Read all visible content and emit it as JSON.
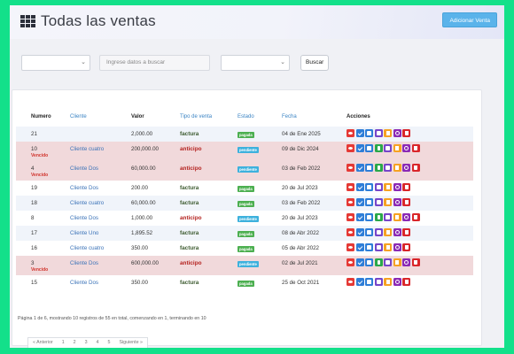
{
  "header": {
    "title": "Todas las ventas",
    "add_button": "Adicionar Venta"
  },
  "filters": {
    "search_placeholder": "Ingrese datos a buscar",
    "search_button": "Buscar"
  },
  "table": {
    "columns": [
      "Numero",
      "Cliente",
      "Valor",
      "Tipo de venta",
      "Estado",
      "Fecha",
      "Acciones"
    ],
    "rows": [
      {
        "numero": "21",
        "vencido": "",
        "cliente": "",
        "valor": "2,000.00",
        "tipo": "factura",
        "estado": "pagada",
        "fecha": "04 de Ene 2025"
      },
      {
        "numero": "10",
        "vencido": "Vencido",
        "cliente": "Cliente cuatro",
        "valor": "200,000.00",
        "tipo": "anticipo",
        "estado": "pendiente",
        "fecha": "09 de Dic 2024"
      },
      {
        "numero": "4",
        "vencido": "Vencido",
        "cliente": "Cliente Dos",
        "valor": "60,000.00",
        "tipo": "anticipo",
        "estado": "pendiente",
        "fecha": "03 de Feb 2022"
      },
      {
        "numero": "19",
        "vencido": "",
        "cliente": "Cliente Dos",
        "valor": "200.00",
        "tipo": "factura",
        "estado": "pagada",
        "fecha": "20 de Jul 2023"
      },
      {
        "numero": "18",
        "vencido": "",
        "cliente": "Cliente cuatro",
        "valor": "60,000.00",
        "tipo": "factura",
        "estado": "pagada",
        "fecha": "03 de Feb 2022"
      },
      {
        "numero": "8",
        "vencido": "",
        "cliente": "Cliente Dos",
        "valor": "1,000.00",
        "tipo": "anticipo",
        "estado": "pendiente",
        "fecha": "20 de Jul 2023"
      },
      {
        "numero": "17",
        "vencido": "",
        "cliente": "Cliente Uno",
        "valor": "1,895.52",
        "tipo": "factura",
        "estado": "pagada",
        "fecha": "08 de Abr 2022"
      },
      {
        "numero": "16",
        "vencido": "",
        "cliente": "Cliente cuatro",
        "valor": "350.00",
        "tipo": "factura",
        "estado": "pagada",
        "fecha": "05 de Abr 2022"
      },
      {
        "numero": "3",
        "vencido": "Vencido",
        "cliente": "Cliente Dos",
        "valor": "600,000.00",
        "tipo": "anticipo",
        "estado": "pendiente",
        "fecha": "02 de Jul 2021"
      },
      {
        "numero": "15",
        "vencido": "",
        "cliente": "Cliente Dos",
        "valor": "350.00",
        "tipo": "factura",
        "estado": "pagada",
        "fecha": "25 de Oct 2021"
      }
    ]
  },
  "footer": {
    "summary": "Página 1 de 6, mostrando 10 registros de 55 en total, comenzando en 1, terminando en 10",
    "pagination": [
      "« Anterior",
      "1",
      "2",
      "3",
      "4",
      "5",
      "Siguiente »"
    ]
  },
  "colors": {
    "accent": "#5ab3ea",
    "pagada": "#4caf50",
    "pendiente": "#3db1dd",
    "vencido_row": "#f1d9db",
    "outer_frame": "#13e08a"
  }
}
